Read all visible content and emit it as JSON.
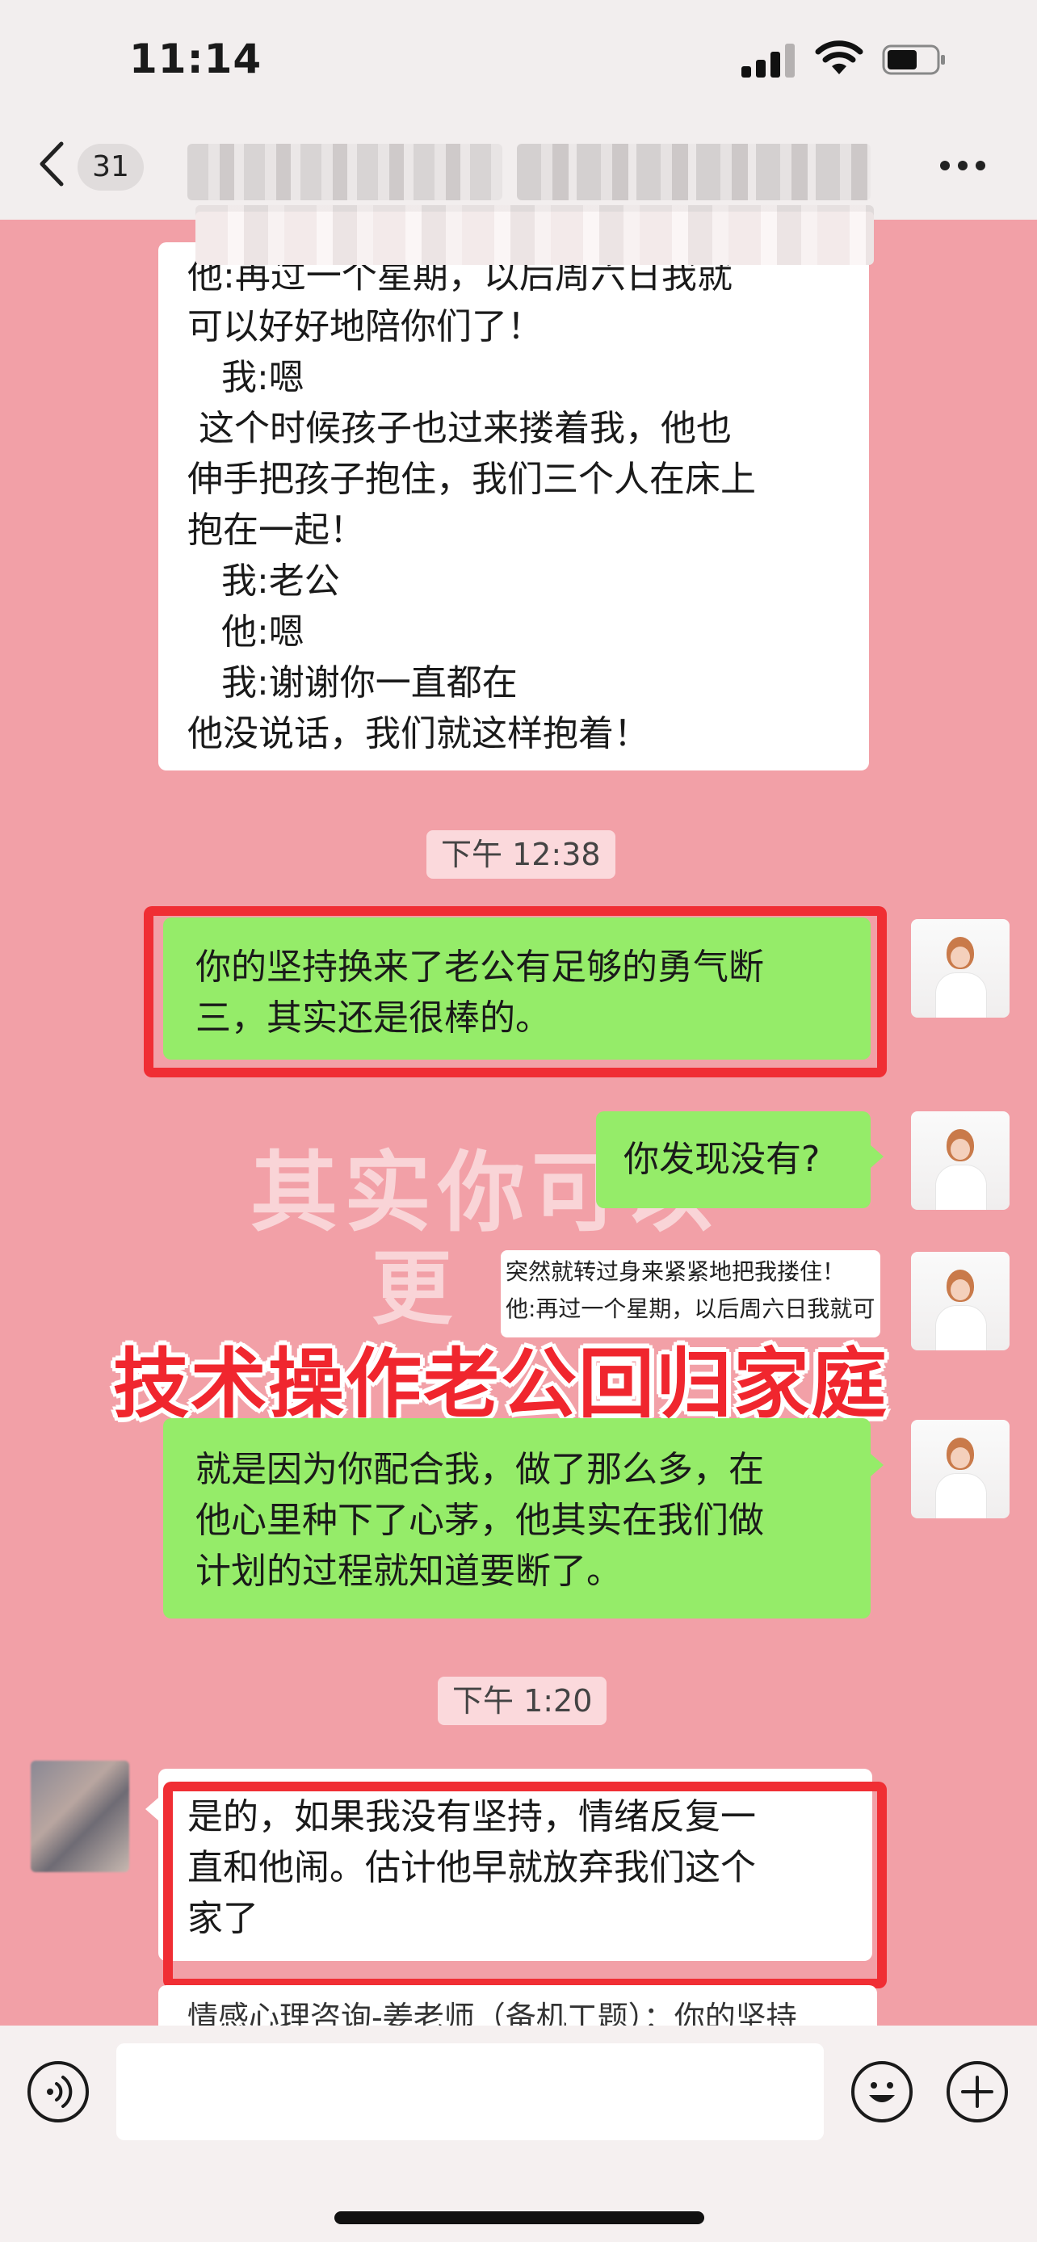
{
  "status_bar": {
    "time": "11:14"
  },
  "nav": {
    "unread_count": "31"
  },
  "messages": {
    "m1": "他:再过一个星期，以后周六日我就\n可以好好地陪你们了！\n   我:嗯\n 这个时候孩子也过来搂着我，他也\n伸手把孩子抱住，我们三个人在床上\n抱在一起！\n   我:老公\n   他:嗯\n   我:谢谢你一直都在\n他没说话，我们就这样抱着！",
    "t1": "下午 12:38",
    "m2": "你的坚持换来了老公有足够的勇气断\n三，其实还是很棒的。",
    "m3": "你发现没有?",
    "quote_line1": "突然就转过身来紧紧地把我搂住！",
    "quote_line2": "他:再过一个星期，以后周六日我就可",
    "m4": "就是因为你配合我，做了那么多，在\n他心里种下了心茅，他其实在我们做\n计划的过程就知道要断了。",
    "t2": "下午 1:20",
    "m5": "是的，如果我没有坚持，情绪反复一\n直和他闹。估计他早就放弃我们这个\n家了",
    "m6_clipped": "情感心理咨询-姜老师（备机工题）：你的坚持"
  },
  "overlays": {
    "title": "技术操作老公回归家庭",
    "watermark_line1": "其实你可以",
    "watermark_line2": "更"
  },
  "colors": {
    "chat_bg": "#f2a0a7",
    "bubble_green": "#95ec69",
    "highlight_red": "#f02e34",
    "overlay_red": "#f0262e"
  },
  "icons": [
    "back-chevron-icon",
    "signal-icon",
    "wifi-icon",
    "battery-icon",
    "more-icon",
    "voice-icon",
    "emoji-icon",
    "plus-icon"
  ]
}
